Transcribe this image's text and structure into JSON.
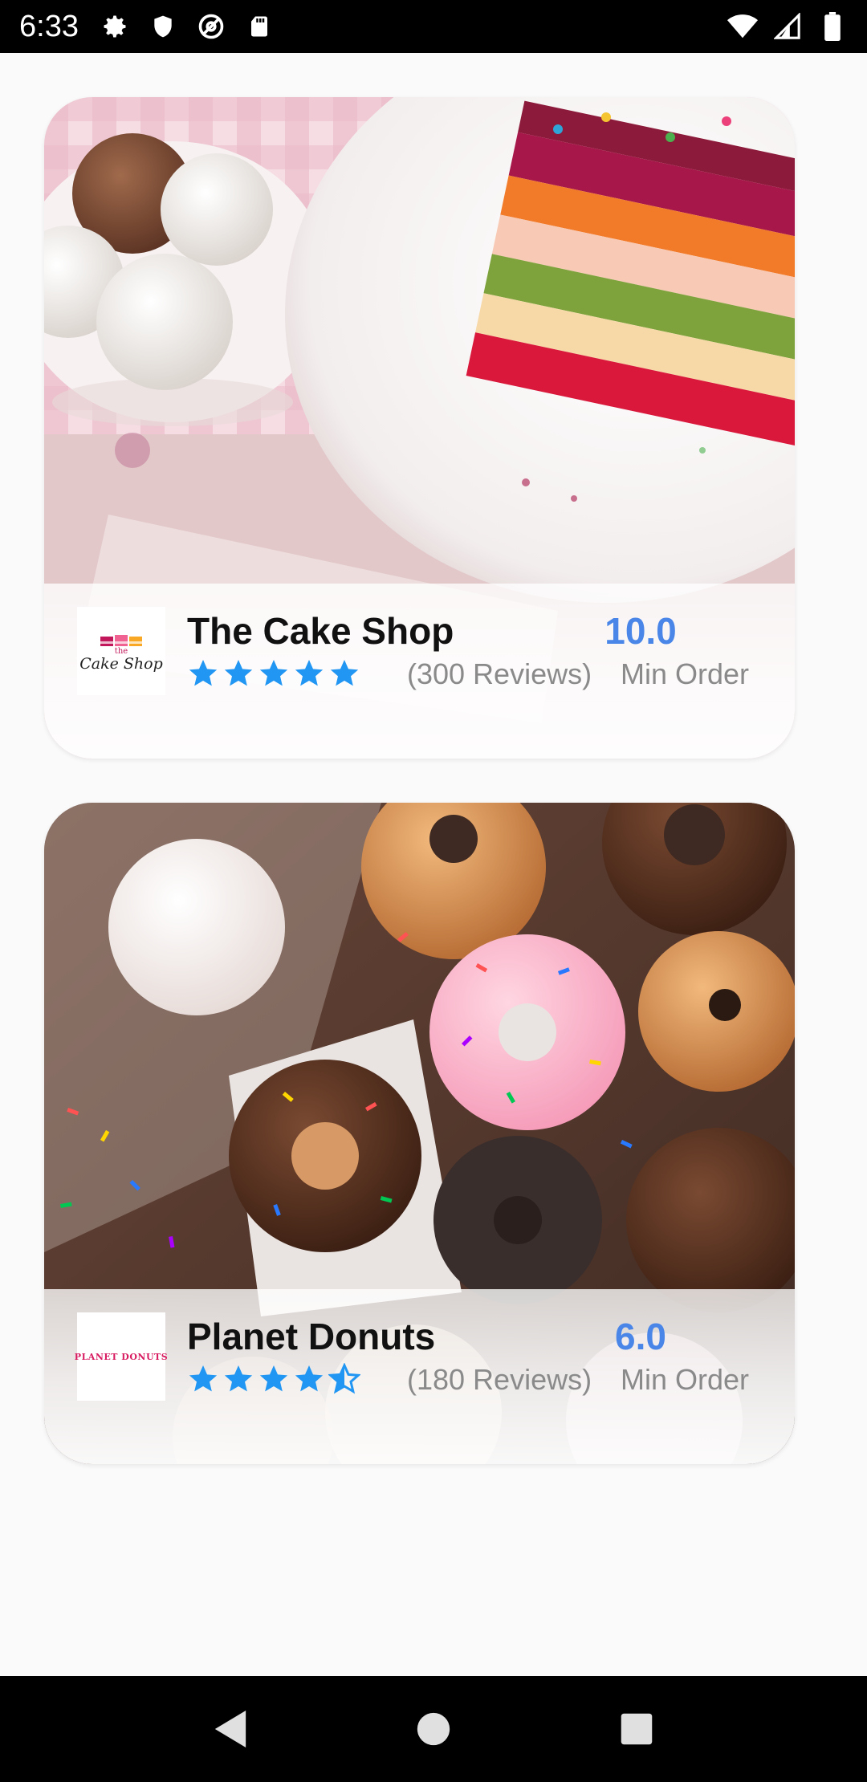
{
  "status_bar": {
    "time": "6:33",
    "left_icons": [
      "settings-icon",
      "shield-icon",
      "at-icon",
      "sd-card-icon"
    ],
    "right_icons": [
      "wifi-icon",
      "signal-icon",
      "battery-icon"
    ]
  },
  "shops": [
    {
      "name": "The Cake Shop",
      "logo_text_top": "the",
      "logo_text": "Cake Shop",
      "rating": 5,
      "reviews": "(300 Reviews)",
      "min_order_value": "10.0",
      "min_order_label": "Min Order"
    },
    {
      "name": "Planet Donuts",
      "logo_text": "PLANET DONUTS",
      "rating": 4.5,
      "reviews": "(180 Reviews)",
      "min_order_value": "6.0",
      "min_order_label": "Min Order"
    }
  ],
  "colors": {
    "star": "#2196f3",
    "min_order_value": "#4a86e8",
    "muted_text": "#8a8a8a"
  },
  "nav_bar": {
    "buttons": [
      "back-icon",
      "home-icon",
      "recents-icon"
    ]
  }
}
